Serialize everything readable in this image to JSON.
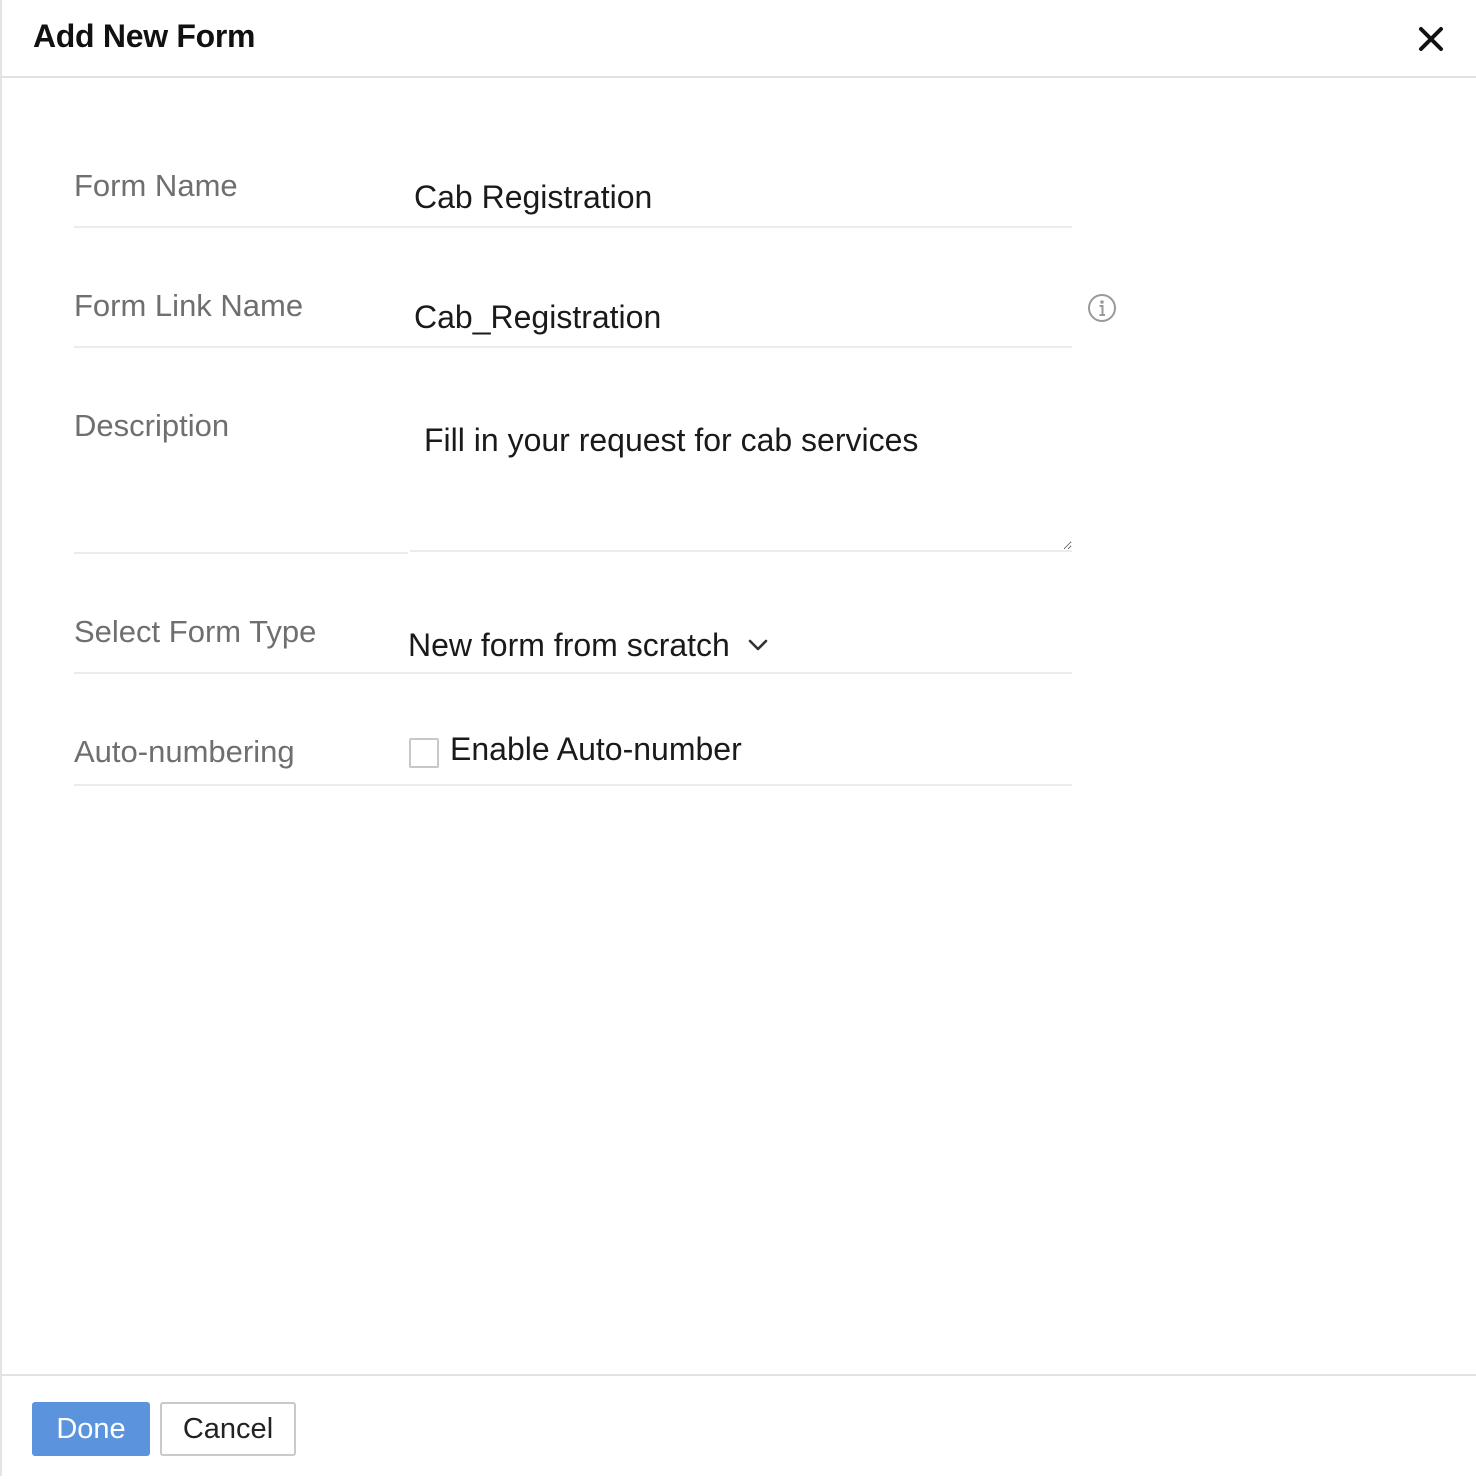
{
  "dialog": {
    "title": "Add New Form"
  },
  "form": {
    "form_name": {
      "label": "Form Name",
      "value": "Cab Registration"
    },
    "form_link_name": {
      "label": "Form Link Name",
      "value": "Cab_Registration"
    },
    "description": {
      "label": "Description",
      "value": "Fill in your request for cab services"
    },
    "form_type": {
      "label": "Select Form Type",
      "selected": "New form from scratch"
    },
    "auto_numbering": {
      "label": "Auto-numbering",
      "checkbox_label": "Enable Auto-number",
      "checked": false
    }
  },
  "footer": {
    "done_label": "Done",
    "cancel_label": "Cancel"
  },
  "colors": {
    "primary_button": "#5b93dd",
    "label_text": "#6f6f6f",
    "divider": "#ececec"
  }
}
